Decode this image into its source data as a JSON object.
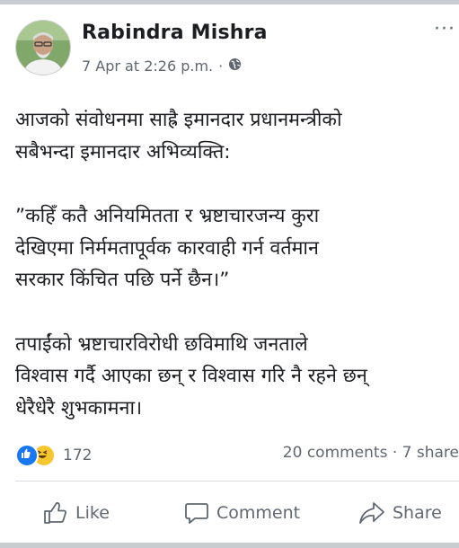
{
  "post": {
    "author": "Rabindra Mishra",
    "date": "7 Apr at 2:26 p.m.",
    "separator": "·",
    "more": "···",
    "lines": [
      "आजको संवोधनमा साह्रै इमानदार प्रधानमन्त्रीको",
      "सबैभन्दा इमानदार अभिव्यक्ति:",
      "",
      "”कहिँ कतै अनियमितता र भ्रष्टाचारजन्य कुरा",
      "देखिएमा निर्ममतापूर्वक कारवाही गर्न वर्तमान",
      "सरकार किंचित पछि पर्ने छैन।”",
      "",
      "तपाईंको भ्रष्टाचारविरोधी छविमाथि जनताले",
      "विश्वास गर्दै आएका छन् र विश्वास गरि नै रहने छन्",
      "धेरैधेरै शुभकामना।"
    ]
  },
  "stats": {
    "reaction_count": "172",
    "engagement": "20 comments · 7 share"
  },
  "actions": {
    "like": "Like",
    "comment": "Comment",
    "share": "Share"
  },
  "colors": {
    "like_blue": "#1877f2",
    "haha_yellow": "#f7c530",
    "muted": "#606770"
  },
  "icons": [
    "globe-icon",
    "like-icon",
    "comment-icon",
    "share-icon",
    "more-icon"
  ]
}
